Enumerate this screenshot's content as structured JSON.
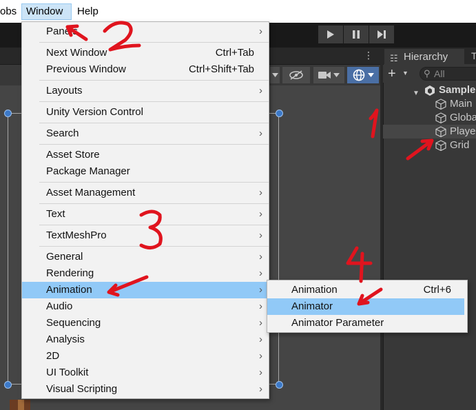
{
  "menubar": {
    "items": [
      {
        "label": "obs",
        "active": false
      },
      {
        "label": "Window",
        "active": true
      },
      {
        "label": "Help",
        "active": false
      }
    ]
  },
  "window_menu": {
    "items": [
      {
        "label": "Panels",
        "shortcut": "",
        "submenu": true
      },
      {
        "label": "Next Window",
        "shortcut": "Ctrl+Tab",
        "submenu": false
      },
      {
        "label": "Previous Window",
        "shortcut": "Ctrl+Shift+Tab",
        "submenu": false
      },
      {
        "label": "Layouts",
        "shortcut": "",
        "submenu": true
      },
      {
        "label": "Unity Version Control",
        "shortcut": "",
        "submenu": false
      },
      {
        "label": "Search",
        "shortcut": "",
        "submenu": true
      },
      {
        "label": "Asset Store",
        "shortcut": "",
        "submenu": false
      },
      {
        "label": "Package Manager",
        "shortcut": "",
        "submenu": false
      },
      {
        "label": "Asset Management",
        "shortcut": "",
        "submenu": true
      },
      {
        "label": "Text",
        "shortcut": "",
        "submenu": true
      },
      {
        "label": "TextMeshPro",
        "shortcut": "",
        "submenu": true
      },
      {
        "label": "General",
        "shortcut": "",
        "submenu": true
      },
      {
        "label": "Rendering",
        "shortcut": "",
        "submenu": true
      },
      {
        "label": "Animation",
        "shortcut": "",
        "submenu": true,
        "highlighted": true
      },
      {
        "label": "Audio",
        "shortcut": "",
        "submenu": true
      },
      {
        "label": "Sequencing",
        "shortcut": "",
        "submenu": true
      },
      {
        "label": "Analysis",
        "shortcut": "",
        "submenu": true
      },
      {
        "label": "2D",
        "shortcut": "",
        "submenu": true
      },
      {
        "label": "UI Toolkit",
        "shortcut": "",
        "submenu": true
      },
      {
        "label": "Visual Scripting",
        "shortcut": "",
        "submenu": true
      }
    ]
  },
  "animation_submenu": {
    "items": [
      {
        "label": "Animation",
        "shortcut": "Ctrl+6"
      },
      {
        "label": "Animator",
        "shortcut": "",
        "highlighted": true
      },
      {
        "label": "Animator Parameter",
        "shortcut": ""
      }
    ]
  },
  "hierarchy": {
    "tab_label": "Hierarchy",
    "search_placeholder": "All",
    "scene_name": "Sample",
    "items": [
      {
        "label": "Main"
      },
      {
        "label": "Globa"
      },
      {
        "label": "Playe",
        "highlighted": true
      },
      {
        "label": "Grid"
      }
    ]
  },
  "annotations": [
    "1",
    "2",
    "3",
    "4",
    "1"
  ],
  "colors": {
    "menu_highlight": "#91c9f7",
    "annotation_red": "#e0141e",
    "unity_dark": "#383838",
    "selection_handle": "#3c79c8"
  }
}
